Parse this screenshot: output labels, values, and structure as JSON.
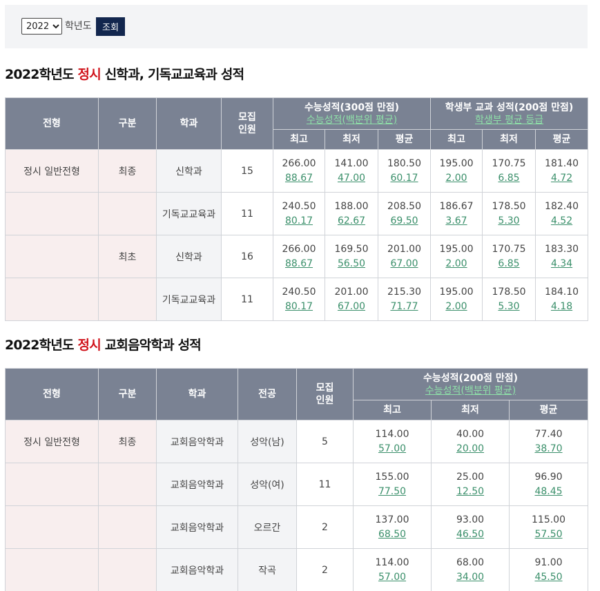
{
  "filter": {
    "year_value": "2022",
    "year_options": [
      "2022"
    ],
    "year_suffix": "학년도",
    "search_label": "조회"
  },
  "section1": {
    "title_prefix": "2022학년도 ",
    "title_highlight": "정시",
    "title_suffix": " 신학과, 기독교교육과 성적",
    "headers": {
      "type": "전형",
      "category": "구분",
      "dept": "학과",
      "quota_line1": "모집",
      "quota_line2": "인원",
      "suneung_title": "수능성적(300점 만점)",
      "suneung_sub": "수능성적(백분위 평균)",
      "school_title": "학생부 교과 성적(200점 만점)",
      "school_sub": "학생부 평균 등급",
      "max": "최고",
      "min": "최저",
      "avg": "평균"
    },
    "rows": [
      {
        "type": "정시 일반전형",
        "category": "최종",
        "dept": "신학과",
        "quota": "15",
        "s_max": "266.00",
        "s_max2": "88.67",
        "s_min": "141.00",
        "s_min2": "47.00",
        "s_avg": "180.50",
        "s_avg2": "60.17",
        "g_max": "195.00",
        "g_max2": "2.00",
        "g_min": "170.75",
        "g_min2": "6.85",
        "g_avg": "181.40",
        "g_avg2": "4.72"
      },
      {
        "type": "",
        "category": "",
        "dept": "기독교교육과",
        "quota": "11",
        "s_max": "240.50",
        "s_max2": "80.17",
        "s_min": "188.00",
        "s_min2": "62.67",
        "s_avg": "208.50",
        "s_avg2": "69.50",
        "g_max": "186.67",
        "g_max2": "3.67",
        "g_min": "178.50",
        "g_min2": "5.30",
        "g_avg": "182.40",
        "g_avg2": "4.52"
      },
      {
        "type": "",
        "category": "최초",
        "dept": "신학과",
        "quota": "16",
        "s_max": "266.00",
        "s_max2": "88.67",
        "s_min": "169.50",
        "s_min2": "56.50",
        "s_avg": "201.00",
        "s_avg2": "67.00",
        "g_max": "195.00",
        "g_max2": "2.00",
        "g_min": "170.75",
        "g_min2": "6.85",
        "g_avg": "183.30",
        "g_avg2": "4.34"
      },
      {
        "type": "",
        "category": "",
        "dept": "기독교교육과",
        "quota": "11",
        "s_max": "240.50",
        "s_max2": "80.17",
        "s_min": "201.00",
        "s_min2": "67.00",
        "s_avg": "215.30",
        "s_avg2": "71.77",
        "g_max": "195.00",
        "g_max2": "2.00",
        "g_min": "178.50",
        "g_min2": "5.30",
        "g_avg": "184.10",
        "g_avg2": "4.18"
      }
    ]
  },
  "section2": {
    "title_prefix": "2022학년도 ",
    "title_highlight": "정시",
    "title_suffix": " 교회음악학과 성적",
    "headers": {
      "type": "전형",
      "category": "구분",
      "dept": "학과",
      "major": "전공",
      "quota_line1": "모집",
      "quota_line2": "인원",
      "suneung_title": "수능성적(200점 만점)",
      "suneung_sub": "수능성적(백분위 평균)",
      "max": "최고",
      "min": "최저",
      "avg": "평균"
    },
    "rows": [
      {
        "type": "정시 일반전형",
        "category": "최종",
        "dept": "교회음악학과",
        "major": "성악(남)",
        "quota": "5",
        "s_max": "114.00",
        "s_max2": "57.00",
        "s_min": "40.00",
        "s_min2": "20.00",
        "s_avg": "77.40",
        "s_avg2": "38.70"
      },
      {
        "type": "",
        "category": "",
        "dept": "교회음악학과",
        "major": "성악(여)",
        "quota": "11",
        "s_max": "155.00",
        "s_max2": "77.50",
        "s_min": "25.00",
        "s_min2": "12.50",
        "s_avg": "96.90",
        "s_avg2": "48.45"
      },
      {
        "type": "",
        "category": "",
        "dept": "교회음악학과",
        "major": "오르간",
        "quota": "2",
        "s_max": "137.00",
        "s_max2": "68.50",
        "s_min": "93.00",
        "s_min2": "46.50",
        "s_avg": "115.00",
        "s_avg2": "57.50"
      },
      {
        "type": "",
        "category": "",
        "dept": "교회음악학과",
        "major": "작곡",
        "quota": "2",
        "s_max": "114.00",
        "s_max2": "57.00",
        "s_min": "68.00",
        "s_min2": "34.00",
        "s_avg": "91.00",
        "s_avg2": "45.50"
      }
    ]
  }
}
